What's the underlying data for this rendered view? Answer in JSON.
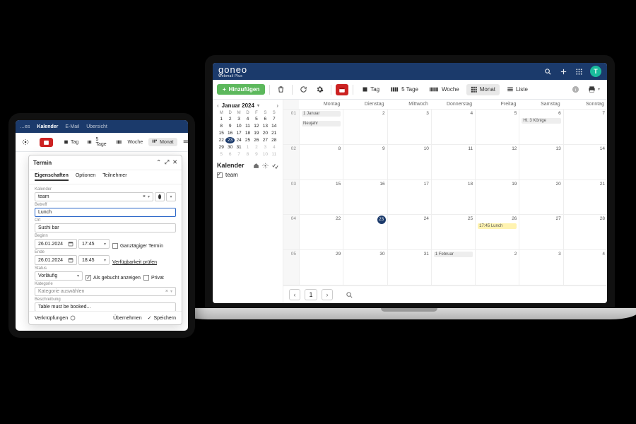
{
  "brand": {
    "name": "goneo",
    "sub": "Webmail Plus"
  },
  "avatar_initial": "T",
  "desktop": {
    "add_label": "Hinzufügen",
    "views": {
      "tag": "Tag",
      "tage5": "5 Tage",
      "woche": "Woche",
      "monat": "Monat",
      "liste": "Liste"
    },
    "active_view": "monat",
    "mini_cal": {
      "title": "Januar 2024",
      "dow": [
        "M",
        "D",
        "M",
        "D",
        "F",
        "S",
        "S"
      ],
      "days": [
        {
          "n": 1
        },
        {
          "n": 2
        },
        {
          "n": 3
        },
        {
          "n": 4
        },
        {
          "n": 5
        },
        {
          "n": 6
        },
        {
          "n": 7
        },
        {
          "n": 8
        },
        {
          "n": 9
        },
        {
          "n": 10
        },
        {
          "n": 11
        },
        {
          "n": 12
        },
        {
          "n": 13
        },
        {
          "n": 14
        },
        {
          "n": 15
        },
        {
          "n": 16
        },
        {
          "n": 17
        },
        {
          "n": 18
        },
        {
          "n": 19
        },
        {
          "n": 20
        },
        {
          "n": 21
        },
        {
          "n": 22
        },
        {
          "n": 23,
          "today": true
        },
        {
          "n": 24
        },
        {
          "n": 25
        },
        {
          "n": 26
        },
        {
          "n": 27
        },
        {
          "n": 28
        },
        {
          "n": 29
        },
        {
          "n": 30
        },
        {
          "n": 31
        },
        {
          "n": 1,
          "out": true
        },
        {
          "n": 2,
          "out": true
        },
        {
          "n": 3,
          "out": true
        },
        {
          "n": 4,
          "out": true
        },
        {
          "n": 5,
          "out": true
        },
        {
          "n": 6,
          "out": true
        },
        {
          "n": 7,
          "out": true
        },
        {
          "n": 8,
          "out": true
        },
        {
          "n": 9,
          "out": true
        },
        {
          "n": 10,
          "out": true
        },
        {
          "n": 11,
          "out": true
        }
      ]
    },
    "calendars_label": "Kalender",
    "calendars": [
      {
        "name": "team",
        "checked": true
      }
    ],
    "month_header": [
      "Montag",
      "Dienstag",
      "Mittwoch",
      "Donnerstag",
      "Freitag",
      "Samstag",
      "Sonntag"
    ],
    "weeks": [
      "01",
      "02",
      "03",
      "04",
      "05"
    ],
    "events": {
      "w01_d1_a": "1 Januar",
      "w01_d1_b": "Neujahr",
      "w01_d6": "Hl. 3 Könige",
      "w04_d5": "17:45 Lunch",
      "w05_d4": "1 Februar"
    },
    "cells": {
      "r1": [
        "",
        "2",
        "3",
        "4",
        "5",
        "6",
        "7"
      ],
      "r2": [
        "8",
        "9",
        "10",
        "11",
        "12",
        "13",
        "14"
      ],
      "r3": [
        "15",
        "16",
        "17",
        "18",
        "19",
        "20",
        "21"
      ],
      "r4": [
        "22",
        "23",
        "24",
        "25",
        "26",
        "27",
        "28"
      ],
      "r5": [
        "29",
        "30",
        "31",
        "",
        "2",
        "3",
        "4"
      ]
    },
    "page": "1"
  },
  "tablet": {
    "nav": {
      "items": [
        "…es",
        "Kalender",
        "E-Mail",
        "Übersicht"
      ],
      "active": 1
    },
    "views": {
      "tag": "Tag",
      "tage5": "5 Tage",
      "woche": "Woche",
      "monat": "Monat",
      "liste": "Liste"
    },
    "active_view": "monat",
    "dialog": {
      "title": "Termin",
      "tabs": [
        "Eigenschaften",
        "Optionen",
        "Teilnehmer"
      ],
      "active_tab": 0,
      "fields": {
        "kalender_label": "Kalender",
        "kalender_value": "team",
        "betreff_label": "Betreff",
        "betreff_value": "Lunch",
        "ort_label": "Ort",
        "ort_value": "Sushi bar",
        "beginn_label": "Beginn",
        "ende_label": "Ende",
        "beginn_date": "26.01.2024",
        "beginn_time": "17:45",
        "ende_date": "26.01.2024",
        "ende_time": "18:45",
        "ganztag_label": "Ganztägiger Termin",
        "verify_label": "Verfügbarkeit prüfen",
        "status_label": "Status",
        "status_value": "Vorläufig",
        "gebucht_label": "Als gebucht anzeigen",
        "privat_label": "Privat",
        "kategorie_label": "Kategorie",
        "kategorie_value": "Kategorie auswählen",
        "beschr_label": "Beschreibung",
        "beschr_value": "Table must be booked..."
      },
      "footer": {
        "links": "Verknüpfungen",
        "uebernehmen": "Übernehmen",
        "speichern": "Speichern"
      }
    }
  }
}
